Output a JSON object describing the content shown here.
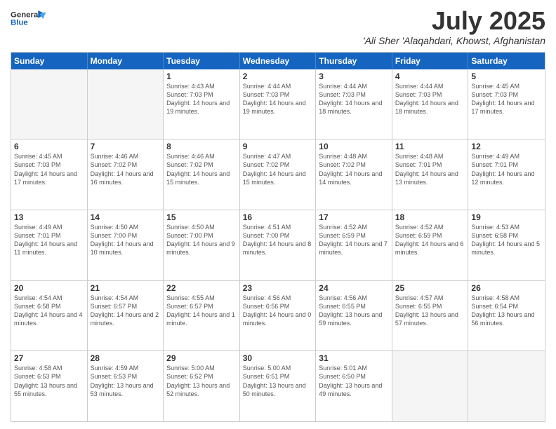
{
  "header": {
    "logo_line1": "General",
    "logo_line2": "Blue",
    "month": "July 2025",
    "location": "'Ali Sher 'Alaqahdari, Khowst, Afghanistan"
  },
  "days_of_week": [
    "Sunday",
    "Monday",
    "Tuesday",
    "Wednesday",
    "Thursday",
    "Friday",
    "Saturday"
  ],
  "weeks": [
    [
      {
        "day": "",
        "info": "",
        "empty": true
      },
      {
        "day": "",
        "info": "",
        "empty": true
      },
      {
        "day": "1",
        "info": "Sunrise: 4:43 AM\nSunset: 7:03 PM\nDaylight: 14 hours and 19 minutes."
      },
      {
        "day": "2",
        "info": "Sunrise: 4:44 AM\nSunset: 7:03 PM\nDaylight: 14 hours and 19 minutes."
      },
      {
        "day": "3",
        "info": "Sunrise: 4:44 AM\nSunset: 7:03 PM\nDaylight: 14 hours and 18 minutes."
      },
      {
        "day": "4",
        "info": "Sunrise: 4:44 AM\nSunset: 7:03 PM\nDaylight: 14 hours and 18 minutes."
      },
      {
        "day": "5",
        "info": "Sunrise: 4:45 AM\nSunset: 7:03 PM\nDaylight: 14 hours and 17 minutes."
      }
    ],
    [
      {
        "day": "6",
        "info": "Sunrise: 4:45 AM\nSunset: 7:03 PM\nDaylight: 14 hours and 17 minutes."
      },
      {
        "day": "7",
        "info": "Sunrise: 4:46 AM\nSunset: 7:02 PM\nDaylight: 14 hours and 16 minutes."
      },
      {
        "day": "8",
        "info": "Sunrise: 4:46 AM\nSunset: 7:02 PM\nDaylight: 14 hours and 15 minutes."
      },
      {
        "day": "9",
        "info": "Sunrise: 4:47 AM\nSunset: 7:02 PM\nDaylight: 14 hours and 15 minutes."
      },
      {
        "day": "10",
        "info": "Sunrise: 4:48 AM\nSunset: 7:02 PM\nDaylight: 14 hours and 14 minutes."
      },
      {
        "day": "11",
        "info": "Sunrise: 4:48 AM\nSunset: 7:01 PM\nDaylight: 14 hours and 13 minutes."
      },
      {
        "day": "12",
        "info": "Sunrise: 4:49 AM\nSunset: 7:01 PM\nDaylight: 14 hours and 12 minutes."
      }
    ],
    [
      {
        "day": "13",
        "info": "Sunrise: 4:49 AM\nSunset: 7:01 PM\nDaylight: 14 hours and 11 minutes."
      },
      {
        "day": "14",
        "info": "Sunrise: 4:50 AM\nSunset: 7:00 PM\nDaylight: 14 hours and 10 minutes."
      },
      {
        "day": "15",
        "info": "Sunrise: 4:50 AM\nSunset: 7:00 PM\nDaylight: 14 hours and 9 minutes."
      },
      {
        "day": "16",
        "info": "Sunrise: 4:51 AM\nSunset: 7:00 PM\nDaylight: 14 hours and 8 minutes."
      },
      {
        "day": "17",
        "info": "Sunrise: 4:52 AM\nSunset: 6:59 PM\nDaylight: 14 hours and 7 minutes."
      },
      {
        "day": "18",
        "info": "Sunrise: 4:52 AM\nSunset: 6:59 PM\nDaylight: 14 hours and 6 minutes."
      },
      {
        "day": "19",
        "info": "Sunrise: 4:53 AM\nSunset: 6:58 PM\nDaylight: 14 hours and 5 minutes."
      }
    ],
    [
      {
        "day": "20",
        "info": "Sunrise: 4:54 AM\nSunset: 6:58 PM\nDaylight: 14 hours and 4 minutes."
      },
      {
        "day": "21",
        "info": "Sunrise: 4:54 AM\nSunset: 6:57 PM\nDaylight: 14 hours and 2 minutes."
      },
      {
        "day": "22",
        "info": "Sunrise: 4:55 AM\nSunset: 6:57 PM\nDaylight: 14 hours and 1 minute."
      },
      {
        "day": "23",
        "info": "Sunrise: 4:56 AM\nSunset: 6:56 PM\nDaylight: 14 hours and 0 minutes."
      },
      {
        "day": "24",
        "info": "Sunrise: 4:56 AM\nSunset: 6:55 PM\nDaylight: 13 hours and 59 minutes."
      },
      {
        "day": "25",
        "info": "Sunrise: 4:57 AM\nSunset: 6:55 PM\nDaylight: 13 hours and 57 minutes."
      },
      {
        "day": "26",
        "info": "Sunrise: 4:58 AM\nSunset: 6:54 PM\nDaylight: 13 hours and 56 minutes."
      }
    ],
    [
      {
        "day": "27",
        "info": "Sunrise: 4:58 AM\nSunset: 6:53 PM\nDaylight: 13 hours and 55 minutes."
      },
      {
        "day": "28",
        "info": "Sunrise: 4:59 AM\nSunset: 6:53 PM\nDaylight: 13 hours and 53 minutes."
      },
      {
        "day": "29",
        "info": "Sunrise: 5:00 AM\nSunset: 6:52 PM\nDaylight: 13 hours and 52 minutes."
      },
      {
        "day": "30",
        "info": "Sunrise: 5:00 AM\nSunset: 6:51 PM\nDaylight: 13 hours and 50 minutes."
      },
      {
        "day": "31",
        "info": "Sunrise: 5:01 AM\nSunset: 6:50 PM\nDaylight: 13 hours and 49 minutes."
      },
      {
        "day": "",
        "info": "",
        "empty": true
      },
      {
        "day": "",
        "info": "",
        "empty": true
      }
    ]
  ]
}
